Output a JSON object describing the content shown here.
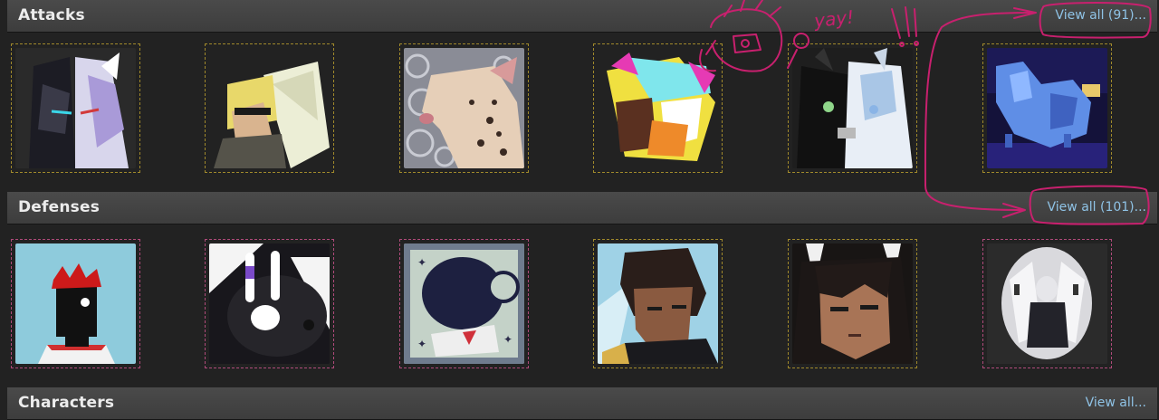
{
  "attacks": {
    "title": "Attacks",
    "view_all": "View all (91)..."
  },
  "defenses": {
    "title": "Defenses",
    "view_all": "View all (101)..."
  },
  "characters": {
    "title": "Characters",
    "view_all": "View all..."
  },
  "annotation": {
    "text": "yay!"
  },
  "colors": {
    "background": "#222222",
    "header": "#444444",
    "link": "#8fc3e6",
    "attack_border": "#a0892b",
    "defense_border": "#b04a7a",
    "scribble": "#c8206e"
  }
}
